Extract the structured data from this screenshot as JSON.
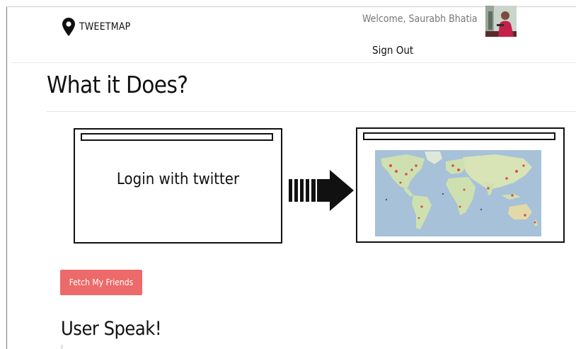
{
  "header": {
    "brand": "TWEETMAP",
    "welcome": "Welcome, Saurabh Bhatia",
    "sign_out": "Sign Out"
  },
  "section": {
    "title": "What it Does?",
    "login_text": "Login with twitter"
  },
  "actions": {
    "fetch_friends": "Fetch My Friends"
  },
  "user_speak": {
    "title": "User Speak!"
  },
  "colors": {
    "button": "#ed6a6a",
    "ocean": "#a7c1d9",
    "land": "#cfe0b0",
    "markers": "#d4504a"
  },
  "icons": {
    "brand": "map-pin-icon",
    "arrow": "arrow-right-icon"
  }
}
